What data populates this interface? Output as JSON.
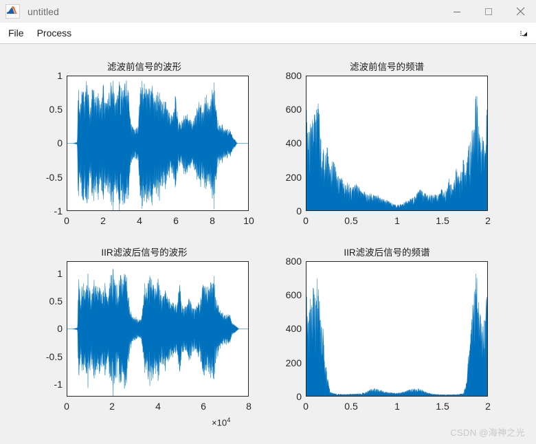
{
  "window": {
    "title": "untitled",
    "icon": "matlab-membrane-icon",
    "controls": {
      "minimize": "minimize-icon",
      "maximize": "maximize-icon",
      "close": "close-icon"
    }
  },
  "menubar": {
    "items": [
      {
        "label": "File"
      },
      {
        "label": "Process"
      }
    ],
    "expand_icon": "toolbar-expand-arrow-icon"
  },
  "watermark": "CSDN @海神之光",
  "colors": {
    "series": "#0072BD",
    "figure_background": "#F0F0F0",
    "axes_background": "#FFFFFF",
    "axes_border": "#262626",
    "tick_label": "#262626",
    "title_text": "#1A1A1A",
    "titlebar_text": "#6D6D6D",
    "watermark": "#C9C9C9"
  },
  "chart_data": [
    {
      "id": "signal-waveform-before",
      "type": "line",
      "title": "滤波前信号的波形",
      "xlabel": "",
      "ylabel": "",
      "xlim": [
        0,
        10
      ],
      "ylim": [
        -1,
        1
      ],
      "xticks": [
        "0",
        "2",
        "4",
        "6",
        "8",
        "10"
      ],
      "xtick_values": [
        0,
        2,
        4,
        6,
        8,
        10
      ],
      "yticks": [
        "-1",
        "-0.5",
        "0",
        "0.5",
        "1"
      ],
      "ytick_values": [
        -1,
        -0.5,
        0,
        0.5,
        1
      ],
      "exponent": "",
      "grid": false,
      "legend": "none",
      "series_color": "#0072BD",
      "description": "Speech audio waveform, dense oscillation filling the vertical range, signal present from x≈0.55 to x≈9.15, clipping at ±1 in loud bursts",
      "envelope": {
        "x": [
          0.0,
          0.3,
          0.55,
          0.62,
          0.7,
          0.8,
          0.95,
          1.1,
          1.25,
          1.4,
          1.55,
          1.7,
          1.85,
          2.0,
          2.15,
          2.3,
          2.45,
          2.6,
          2.75,
          2.9,
          3.05,
          3.2,
          3.35,
          3.5,
          3.62,
          3.75,
          3.9,
          4.05,
          4.2,
          4.35,
          4.5,
          4.65,
          4.8,
          4.95,
          5.1,
          5.25,
          5.4,
          5.55,
          5.7,
          5.85,
          6.0,
          6.15,
          6.3,
          6.45,
          6.6,
          6.75,
          6.9,
          7.05,
          7.2,
          7.35,
          7.5,
          7.65,
          7.8,
          7.95,
          8.1,
          8.25,
          8.4,
          8.55,
          8.7,
          8.85,
          9.0,
          9.15,
          9.4,
          10.0
        ],
        "y": [
          0.0,
          0.0,
          0.02,
          1.0,
          0.46,
          1.0,
          0.92,
          1.0,
          0.62,
          1.0,
          0.72,
          0.96,
          0.6,
          0.95,
          0.7,
          0.88,
          1.0,
          1.0,
          0.82,
          1.0,
          1.0,
          1.0,
          0.95,
          0.4,
          0.26,
          0.22,
          0.3,
          1.0,
          0.95,
          1.0,
          1.0,
          0.97,
          0.88,
          0.8,
          0.86,
          0.74,
          0.66,
          0.58,
          0.52,
          0.44,
          0.8,
          0.4,
          0.36,
          0.48,
          0.52,
          0.4,
          0.36,
          0.46,
          0.6,
          0.7,
          0.52,
          0.96,
          0.62,
          0.86,
          1.0,
          0.52,
          0.33,
          0.3,
          0.26,
          0.24,
          0.22,
          0.12,
          0.0,
          0.0
        ]
      }
    },
    {
      "id": "spectrum-before",
      "type": "line",
      "title": "滤波前信号的频谱",
      "xlabel": "",
      "ylabel": "",
      "xlim": [
        0,
        2
      ],
      "ylim": [
        0,
        800
      ],
      "xticks": [
        "0",
        "0.5",
        "1",
        "1.5",
        "2"
      ],
      "xtick_values": [
        0,
        0.5,
        1,
        1.5,
        2
      ],
      "yticks": [
        "0",
        "200",
        "400",
        "600",
        "800"
      ],
      "ytick_values": [
        0,
        200,
        400,
        600,
        800
      ],
      "exponent": "",
      "grid": false,
      "legend": "none",
      "series_color": "#0072BD",
      "description": "Two-sided FFT magnitude spectrum, symmetric about x=1, large low-frequency lobes peaking near 760 at x≈0.12 and x≈1.88, broad noise floor across mid band",
      "envelope": {
        "x": [
          0.0,
          0.02,
          0.04,
          0.06,
          0.08,
          0.1,
          0.12,
          0.14,
          0.16,
          0.18,
          0.2,
          0.23,
          0.26,
          0.3,
          0.34,
          0.38,
          0.42,
          0.46,
          0.5,
          0.55,
          0.6,
          0.65,
          0.7,
          0.75,
          0.8,
          0.85,
          0.9,
          0.95,
          1.0,
          1.05,
          1.1,
          1.15,
          1.2,
          1.25,
          1.3,
          1.35,
          1.4,
          1.45,
          1.5,
          1.54,
          1.58,
          1.62,
          1.66,
          1.7,
          1.74,
          1.77,
          1.8,
          1.82,
          1.84,
          1.86,
          1.88,
          1.9,
          1.92,
          1.94,
          1.96,
          1.98,
          2.0
        ],
        "y": [
          690,
          420,
          600,
          520,
          700,
          560,
          760,
          600,
          420,
          450,
          300,
          390,
          240,
          330,
          200,
          230,
          150,
          170,
          130,
          160,
          120,
          110,
          105,
          95,
          80,
          70,
          60,
          45,
          30,
          40,
          55,
          70,
          85,
          130,
          110,
          95,
          100,
          90,
          135,
          100,
          200,
          140,
          260,
          180,
          330,
          260,
          430,
          350,
          600,
          520,
          760,
          600,
          480,
          430,
          520,
          440,
          690
        ]
      }
    },
    {
      "id": "signal-waveform-after-iir",
      "type": "line",
      "title": "IIR滤波后信号的波形",
      "xlabel": "",
      "ylabel": "",
      "xlim": [
        0,
        8
      ],
      "ylim": [
        -1.35,
        1.35
      ],
      "xticks": [
        "0",
        "2",
        "4",
        "6",
        "8"
      ],
      "xtick_values": [
        0,
        2,
        4,
        6,
        8
      ],
      "yticks": [
        "-1",
        "-0.5",
        "0",
        "0.5",
        "1"
      ],
      "ytick_values": [
        -1,
        -0.5,
        0,
        0.5,
        1
      ],
      "exponent": "×10⁴",
      "exponent_mantissa": "×10",
      "exponent_power": "4",
      "grid": false,
      "legend": "none",
      "series_color": "#0072BD",
      "description": "IIR-filtered speech waveform in samples, signal present from x≈0.45e4 to x≈7.3e4, peaks reaching about ±1.3",
      "envelope": {
        "x": [
          0.0,
          0.25,
          0.45,
          0.5,
          0.58,
          0.68,
          0.8,
          0.92,
          1.05,
          1.18,
          1.3,
          1.42,
          1.55,
          1.68,
          1.8,
          1.92,
          2.05,
          2.15,
          2.25,
          2.35,
          2.45,
          2.55,
          2.65,
          2.75,
          2.85,
          2.95,
          3.05,
          3.15,
          3.3,
          3.45,
          3.55,
          3.65,
          3.75,
          3.85,
          3.95,
          4.05,
          4.15,
          4.25,
          4.35,
          4.45,
          4.55,
          4.65,
          4.75,
          4.85,
          4.95,
          5.05,
          5.15,
          5.25,
          5.4,
          5.55,
          5.7,
          5.85,
          6.0,
          6.15,
          6.3,
          6.45,
          6.6,
          6.75,
          6.9,
          7.05,
          7.2,
          7.3,
          7.6,
          8.0
        ],
        "y": [
          0.0,
          0.0,
          0.03,
          1.3,
          0.55,
          1.22,
          1.05,
          1.16,
          0.7,
          1.2,
          0.85,
          1.1,
          0.72,
          1.05,
          0.8,
          1.26,
          1.32,
          1.0,
          0.88,
          1.2,
          1.22,
          1.26,
          1.0,
          0.55,
          0.32,
          0.24,
          0.26,
          0.22,
          0.3,
          1.2,
          0.95,
          1.26,
          1.05,
          1.15,
          0.92,
          1.1,
          0.86,
          0.78,
          0.9,
          0.8,
          0.7,
          0.62,
          0.56,
          0.5,
          1.22,
          0.58,
          0.5,
          0.6,
          0.64,
          0.52,
          0.48,
          0.56,
          1.08,
          0.85,
          1.02,
          1.22,
          0.7,
          0.42,
          0.36,
          0.33,
          0.3,
          0.14,
          0.0,
          0.0
        ]
      }
    },
    {
      "id": "spectrum-after-iir",
      "type": "line",
      "title": "IIR滤波后信号的频谱",
      "xlabel": "",
      "ylabel": "",
      "xlim": [
        0,
        2
      ],
      "ylim": [
        0,
        800
      ],
      "xticks": [
        "0",
        "0.5",
        "1",
        "1.5",
        "2"
      ],
      "xtick_values": [
        0,
        0.5,
        1,
        1.5,
        2
      ],
      "yticks": [
        "0",
        "200",
        "400",
        "600",
        "800"
      ],
      "ytick_values": [
        0,
        200,
        400,
        600,
        800
      ],
      "exponent": "",
      "grid": false,
      "legend": "none",
      "series_color": "#0072BD",
      "description": "Spectrum after IIR low-pass filtering: strong lobes retained below x≈0.25 and above x≈1.75 (peaks ≈760), mid band suppressed to small residual humps near x≈0.75 and x≈1.25 (≈45)",
      "envelope": {
        "x": [
          0.0,
          0.02,
          0.04,
          0.06,
          0.08,
          0.1,
          0.12,
          0.14,
          0.16,
          0.18,
          0.2,
          0.22,
          0.24,
          0.26,
          0.28,
          0.32,
          0.4,
          0.5,
          0.6,
          0.66,
          0.7,
          0.75,
          0.8,
          0.85,
          0.9,
          0.95,
          1.0,
          1.05,
          1.1,
          1.15,
          1.2,
          1.25,
          1.3,
          1.35,
          1.4,
          1.5,
          1.6,
          1.68,
          1.72,
          1.74,
          1.76,
          1.78,
          1.8,
          1.82,
          1.84,
          1.86,
          1.88,
          1.9,
          1.92,
          1.94,
          1.96,
          1.98,
          2.0
        ],
        "y": [
          690,
          430,
          600,
          530,
          700,
          570,
          760,
          610,
          430,
          460,
          280,
          180,
          90,
          40,
          20,
          14,
          10,
          12,
          15,
          25,
          38,
          48,
          42,
          30,
          22,
          20,
          18,
          22,
          30,
          40,
          46,
          44,
          30,
          18,
          12,
          8,
          8,
          10,
          14,
          24,
          60,
          140,
          300,
          420,
          560,
          640,
          760,
          620,
          500,
          440,
          530,
          450,
          690
        ]
      }
    }
  ]
}
